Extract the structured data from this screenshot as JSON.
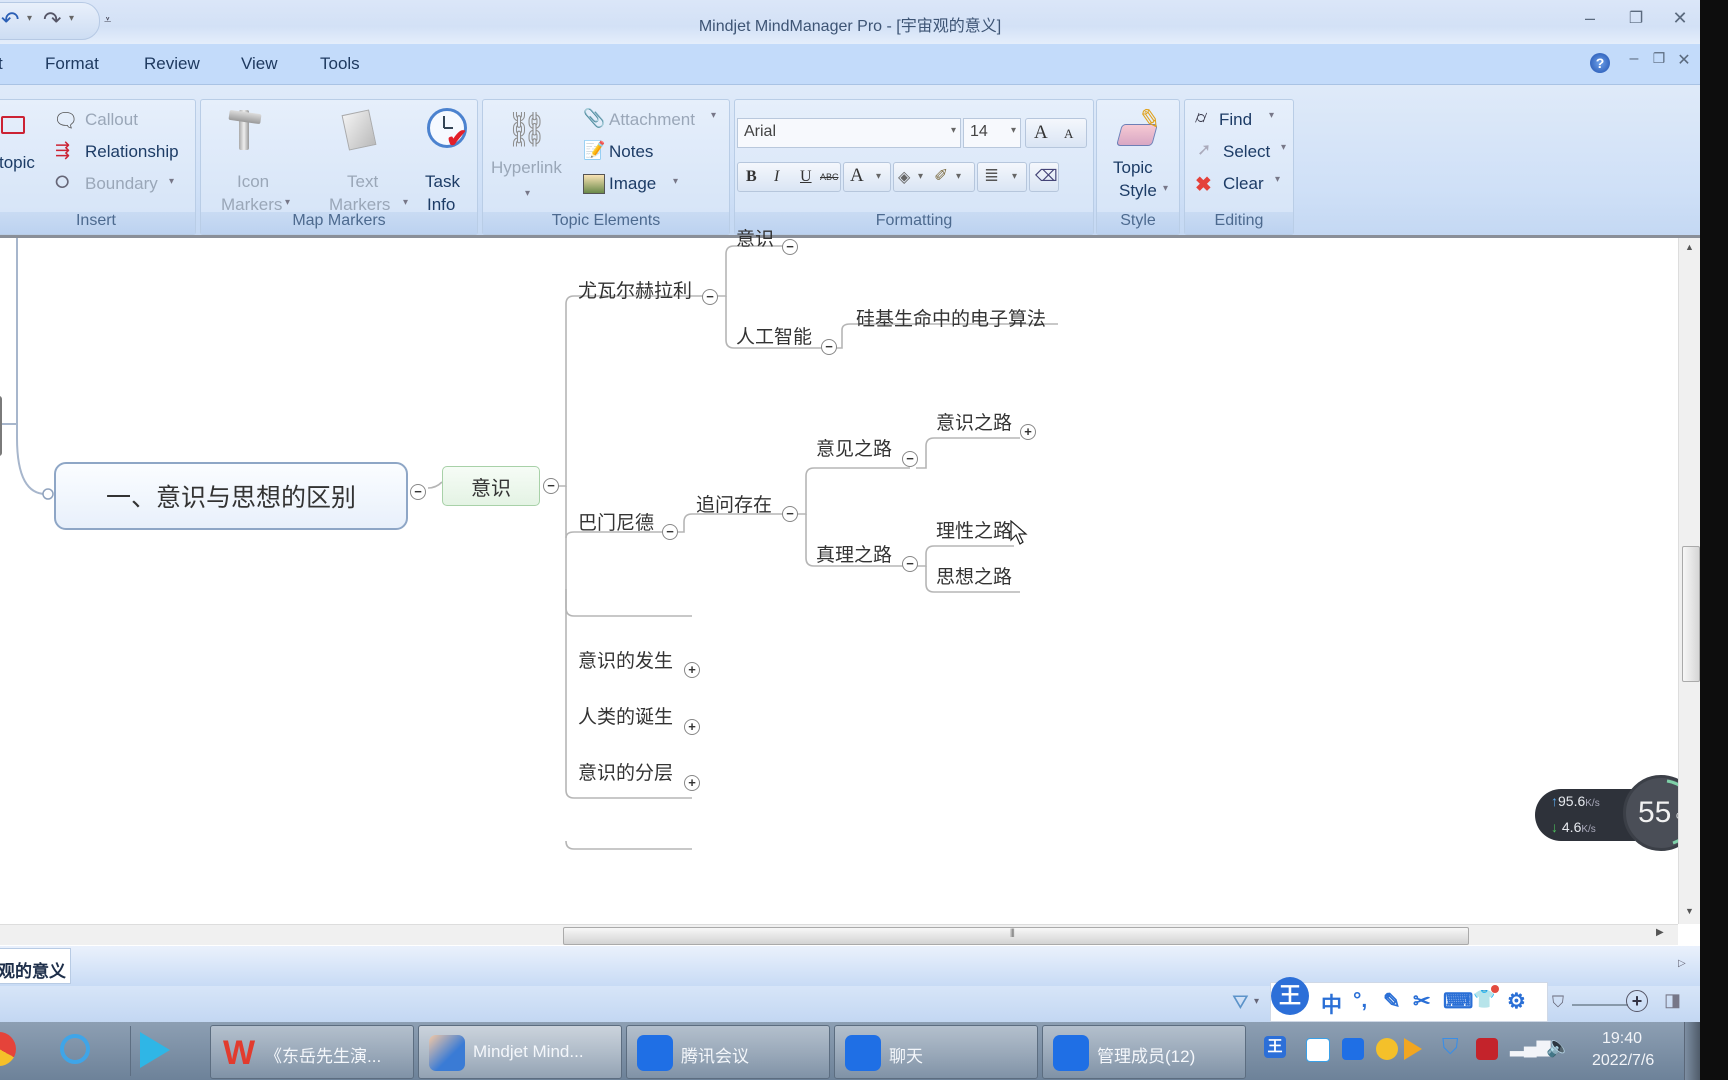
{
  "window": {
    "title": "Mindjet MindManager Pro - [宇宙观的意义]",
    "minimize": "–",
    "restore": "❐",
    "close": "✕"
  },
  "menu": {
    "items": [
      "t",
      "Format",
      "Review",
      "View",
      "Tools"
    ],
    "help": "?",
    "doc_min": "–",
    "doc_restore": "❐",
    "doc_close": "✕"
  },
  "ribbon": {
    "insert": {
      "label": "Insert",
      "subtopic": "topic",
      "callout": "Callout",
      "relationship": "Relationship",
      "boundary": "Boundary"
    },
    "map_markers": {
      "label": "Map Markers",
      "icon_markers": [
        "Icon",
        "Markers"
      ],
      "text_markers": [
        "Text",
        "Markers"
      ],
      "task_info": [
        "Task",
        "Info"
      ]
    },
    "topic_elements": {
      "label": "Topic Elements",
      "hyperlink": "Hyperlink",
      "attachment": "Attachment",
      "notes": "Notes",
      "image": "Image"
    },
    "formatting": {
      "label": "Formatting",
      "font": "Arial",
      "size": "14",
      "bold": "B",
      "italic": "I",
      "underline": "U",
      "strike": "ABC",
      "font_color": "A",
      "grow": "A",
      "shrink": "A"
    },
    "style": {
      "label": "Style",
      "topic_style": [
        "Topic",
        "Style"
      ]
    },
    "editing": {
      "label": "Editing",
      "find": "Find",
      "select": "Select",
      "clear": "Clear"
    }
  },
  "map": {
    "central": "一、意识与思想的区别",
    "main": "意识",
    "branches": [
      {
        "label": "尤瓦尔赫拉利",
        "children": [
          {
            "label": "意识"
          },
          {
            "label": "人工智能",
            "children": [
              {
                "label": "硅基生命中的电子算法"
              }
            ]
          }
        ]
      },
      {
        "label": "巴门尼德",
        "children": [
          {
            "label": "追问存在",
            "children": [
              {
                "label": "意见之路",
                "children": [
                  {
                    "label": "意识之路"
                  }
                ]
              },
              {
                "label": "真理之路",
                "children": [
                  {
                    "label": "理性之路"
                  },
                  {
                    "label": "思想之路"
                  }
                ]
              }
            ]
          }
        ]
      },
      {
        "label": "意识的发生"
      },
      {
        "label": "人类的诞生"
      },
      {
        "label": "意识的分层"
      }
    ],
    "collapse": "−",
    "expand": "+"
  },
  "document_tab": "观的意义",
  "net_monitor": {
    "upload": "95.6",
    "download": "4.6",
    "unit": "K/s",
    "percent": "55",
    "percent_sign": "%"
  },
  "ime_toolbar": [
    "王",
    "中",
    "°,",
    "✎",
    "✂",
    "⌨",
    "👕",
    "⚙"
  ],
  "taskbar": {
    "buttons": [
      {
        "label": "《东岳先生演...",
        "color": "#e23b2e"
      },
      {
        "label": "Mindjet Mind...",
        "color": "#3a7bd5"
      },
      {
        "label": "腾讯会议",
        "color": "#1f6fe5"
      },
      {
        "label": "聊天",
        "color": "#1f6fe5"
      },
      {
        "label": "管理成员(12)",
        "color": "#1f6fe5"
      }
    ],
    "time": "19:40",
    "date": "2022/7/6"
  }
}
